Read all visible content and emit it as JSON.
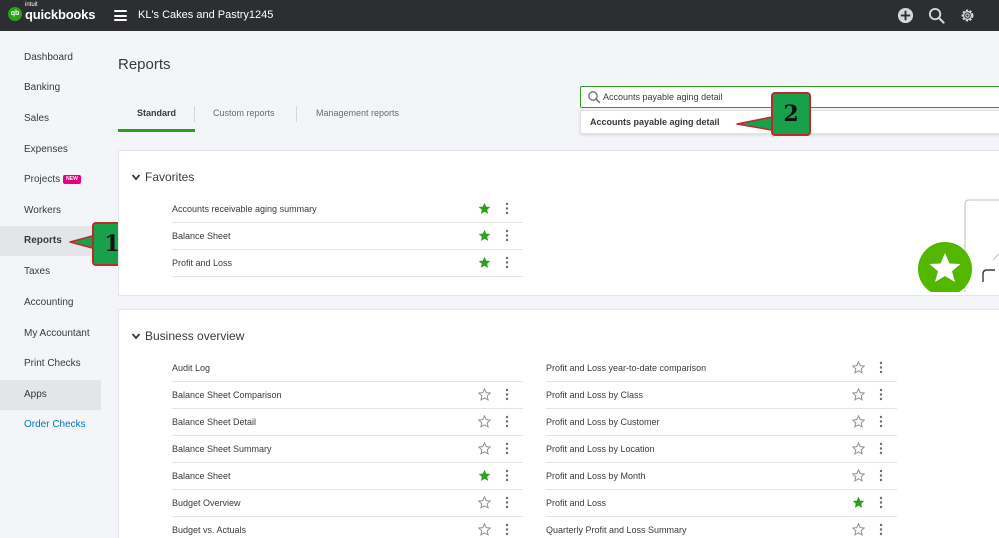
{
  "topbar": {
    "logo_badge": "qb",
    "logo_intuit": "intuit",
    "logo_text": "quickbooks",
    "company": "KL's Cakes and Pastry1245"
  },
  "sidebar": {
    "items": [
      {
        "label": "Dashboard"
      },
      {
        "label": "Banking"
      },
      {
        "label": "Sales"
      },
      {
        "label": "Expenses"
      },
      {
        "label": "Projects",
        "badge": "NEW"
      },
      {
        "label": "Workers"
      },
      {
        "label": "Reports"
      },
      {
        "label": "Taxes"
      },
      {
        "label": "Accounting"
      },
      {
        "label": "My Accountant"
      },
      {
        "label": "Print Checks"
      },
      {
        "label": "Apps"
      },
      {
        "label": "Order Checks"
      }
    ]
  },
  "callouts": {
    "one": "1",
    "two": "2"
  },
  "page": {
    "title": "Reports",
    "tabs": [
      {
        "label": "Standard"
      },
      {
        "label": "Custom reports"
      },
      {
        "label": "Management reports"
      }
    ]
  },
  "search": {
    "value": "Accounts payable aging detail",
    "suggestion": "Accounts payable aging detail"
  },
  "favorites": {
    "title": "Favorites",
    "rows": [
      {
        "name": "Accounts receivable aging summary",
        "starred": true
      },
      {
        "name": "Balance Sheet",
        "starred": true
      },
      {
        "name": "Profit and Loss",
        "starred": true
      }
    ]
  },
  "business_overview": {
    "title": "Business overview",
    "left": [
      {
        "name": "Audit Log",
        "starred": false,
        "actions": false
      },
      {
        "name": "Balance Sheet Comparison",
        "starred": false
      },
      {
        "name": "Balance Sheet Detail",
        "starred": false
      },
      {
        "name": "Balance Sheet Summary",
        "starred": false
      },
      {
        "name": "Balance Sheet",
        "starred": true
      },
      {
        "name": "Budget Overview",
        "starred": false
      },
      {
        "name": "Budget vs. Actuals",
        "starred": false
      }
    ],
    "right": [
      {
        "name": "Profit and Loss year-to-date comparison",
        "starred": false
      },
      {
        "name": "Profit and Loss by Class",
        "starred": false
      },
      {
        "name": "Profit and Loss by Customer",
        "starred": false
      },
      {
        "name": "Profit and Loss by Location",
        "starred": false
      },
      {
        "name": "Profit and Loss by Month",
        "starred": false
      },
      {
        "name": "Profit and Loss",
        "starred": true
      },
      {
        "name": "Quarterly Profit and Loss Summary",
        "starred": false
      }
    ]
  },
  "colors": {
    "brand_green": "#2ca01c",
    "topbar": "#2d2e31",
    "callout_fill": "#19a04a",
    "callout_border": "#c2262e",
    "link_blue": "#0077c5"
  }
}
